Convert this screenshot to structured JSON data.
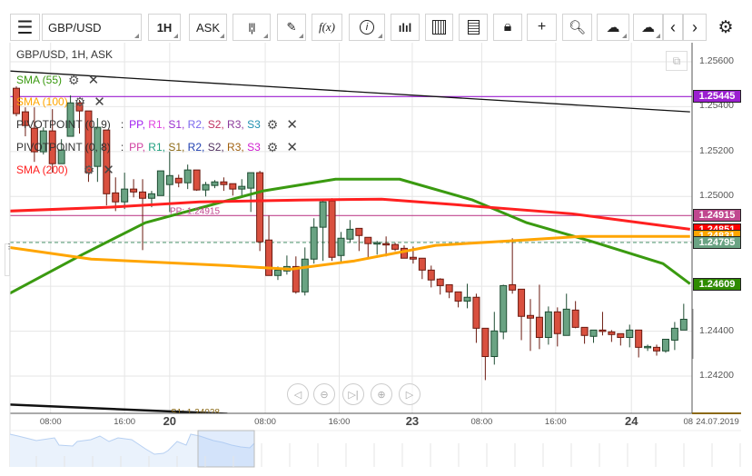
{
  "toolbar": {
    "menu_icon": "hamburger-icon",
    "symbol": "GBP/USD",
    "timeframe": "1H",
    "price_side": "ASK",
    "fx_label": "f(x)",
    "icons": [
      "candles-icon",
      "pen-icon",
      "function-icon",
      "info-icon",
      "bars-icon",
      "calendar-icon",
      "document-icon",
      "lock-icon",
      "crosshair-icon",
      "zoom-chart-icon",
      "cloud-upload-icon",
      "cloud-download-icon",
      "chevron-left-icon",
      "chevron-right-icon",
      "gear-icon"
    ]
  },
  "legend": {
    "title": "GBP/USD, 1H, ASK",
    "sma55": {
      "label": "SMA (55)",
      "color": "#3a9a10"
    },
    "sma100": {
      "label": "SMA (100)",
      "color": "#ffa500"
    },
    "pivot9": {
      "label": "PIVOTPOINT (0, 9)",
      "sep": ":",
      "items": [
        {
          "t": "PP",
          "c": "#a020f0"
        },
        {
          "t": "R1",
          "c": "#e040e0"
        },
        {
          "t": "S1",
          "c": "#9b30d0"
        },
        {
          "t": "R2",
          "c": "#7b68ee"
        },
        {
          "t": "S2",
          "c": "#c03060"
        },
        {
          "t": "R3",
          "c": "#8b3a9b"
        },
        {
          "t": "S3",
          "c": "#2090b0"
        }
      ]
    },
    "pivot8": {
      "label": "PIVOTPOINT (0, 8)",
      "sep": ":",
      "items": [
        {
          "t": "PP",
          "c": "#d040a0"
        },
        {
          "t": "R1",
          "c": "#20a080"
        },
        {
          "t": "S1",
          "c": "#8b6914"
        },
        {
          "t": "R2",
          "c": "#2040b0"
        },
        {
          "t": "S2",
          "c": "#503060"
        },
        {
          "t": "R3",
          "c": "#a06010"
        },
        {
          "t": "S3",
          "c": "#d020d0"
        }
      ]
    },
    "sma200": {
      "label": "SMA (200)",
      "color": "#ff2020"
    }
  },
  "chart_data": {
    "type": "candlestick",
    "symbol": "GBP/USD",
    "interval": "1H",
    "ylim": [
      1.2415,
      1.2567
    ],
    "yticks": [
      "1.25600",
      "1.25400",
      "1.25200",
      "1.25000",
      "1.24800",
      "1.24600",
      "1.24400",
      "1.24200"
    ],
    "ytick_values": [
      1.256,
      1.254,
      1.252,
      1.25,
      1.248,
      1.246,
      1.244,
      1.242
    ],
    "grid": true,
    "up_color": "#6aa383",
    "down_color": "#d9503f",
    "candles_ohlc": [
      [
        1.25482,
        1.2549,
        1.25357,
        1.25369
      ],
      [
        1.25377,
        1.25397,
        1.25268,
        1.25316
      ],
      [
        1.25304,
        1.25397,
        1.25154,
        1.25199
      ],
      [
        1.25199,
        1.25308,
        1.25187,
        1.25292
      ],
      [
        1.25292,
        1.25389,
        1.25106,
        1.25146
      ],
      [
        1.25146,
        1.25255,
        1.25146,
        1.25207
      ],
      [
        1.25268,
        1.2545,
        1.25268,
        1.25417
      ],
      [
        1.25417,
        1.2543,
        1.2528,
        1.25381
      ],
      [
        1.25381,
        1.25381,
        1.25065,
        1.25106
      ],
      [
        1.25134,
        1.25349,
        1.25065,
        1.25308
      ],
      [
        1.25296,
        1.25296,
        1.2496,
        1.25012
      ],
      [
        1.25016,
        1.25085,
        1.24935,
        1.24976
      ],
      [
        1.24976,
        1.25106,
        1.24944,
        1.25033
      ],
      [
        1.25033,
        1.25077,
        1.24996,
        1.2502
      ],
      [
        1.2502,
        1.25077,
        1.24761,
        1.24992
      ],
      [
        1.24992,
        1.25025,
        1.24952,
        1.25012
      ],
      [
        1.25004,
        1.25114,
        1.25004,
        1.25114
      ],
      [
        1.25053,
        1.25199,
        1.24931,
        1.25093
      ],
      [
        1.25081,
        1.25097,
        1.25041,
        1.25061
      ],
      [
        1.25061,
        1.25142,
        1.25033,
        1.25118
      ],
      [
        1.25118,
        1.25118,
        1.25025,
        1.25029
      ],
      [
        1.25029,
        1.25065,
        1.25,
        1.25053
      ],
      [
        1.25049,
        1.25073,
        1.25037,
        1.25065
      ],
      [
        1.25065,
        1.25085,
        1.25025,
        1.25053
      ],
      [
        1.25057,
        1.25057,
        1.25004,
        1.25033
      ],
      [
        1.25033,
        1.25077,
        1.25004,
        1.25045
      ],
      [
        1.25037,
        1.25106,
        1.24931,
        1.25106
      ],
      [
        1.25106,
        1.25114,
        1.24757,
        1.24798
      ],
      [
        1.24806,
        1.24915,
        1.24648,
        1.24648
      ],
      [
        1.24648,
        1.24688,
        1.24628,
        1.24672
      ],
      [
        1.24668,
        1.24737,
        1.24652,
        1.24688
      ],
      [
        1.24688,
        1.24733,
        1.24567,
        1.24575
      ],
      [
        1.24575,
        1.24773,
        1.24559,
        1.24721
      ],
      [
        1.24721,
        1.24903,
        1.24701,
        1.24863
      ],
      [
        1.24863,
        1.24988,
        1.24713,
        1.24976
      ],
      [
        1.2498,
        1.24992,
        1.24713,
        1.24729
      ],
      [
        1.24737,
        1.24842,
        1.24701,
        1.24814
      ],
      [
        1.2481,
        1.24895,
        1.24794,
        1.24854
      ],
      [
        1.24858,
        1.24858,
        1.24757,
        1.24826
      ],
      [
        1.24818,
        1.24818,
        1.24729,
        1.2479
      ],
      [
        1.2479,
        1.24802,
        1.24741,
        1.24794
      ],
      [
        1.2479,
        1.24822,
        1.24733,
        1.24786
      ],
      [
        1.24786,
        1.24794,
        1.24757,
        1.24765
      ],
      [
        1.24769,
        1.24782,
        1.24725,
        1.24725
      ],
      [
        1.24729,
        1.24777,
        1.24701,
        1.24721
      ],
      [
        1.24725,
        1.24725,
        1.24632,
        1.24672
      ],
      [
        1.24672,
        1.24692,
        1.24595,
        1.24628
      ],
      [
        1.24632,
        1.24636,
        1.24563,
        1.24603
      ],
      [
        1.24607,
        1.24607,
        1.24547,
        1.24575
      ],
      [
        1.24575,
        1.24575,
        1.24506,
        1.24534
      ],
      [
        1.24534,
        1.24611,
        1.24502,
        1.24551
      ],
      [
        1.24551,
        1.24567,
        1.24348,
        1.24413
      ],
      [
        1.24413,
        1.24413,
        1.24182,
        1.24287
      ],
      [
        1.24287,
        1.24486,
        1.24251,
        1.24401
      ],
      [
        1.24397,
        1.24607,
        1.24364,
        1.24603
      ],
      [
        1.24607,
        1.24814,
        1.24567,
        1.24583
      ],
      [
        1.24587,
        1.24587,
        1.2436,
        1.24466
      ],
      [
        1.2447,
        1.24543,
        1.24312,
        1.24458
      ],
      [
        1.24462,
        1.24607,
        1.2432,
        1.24372
      ],
      [
        1.24372,
        1.2451,
        1.2434,
        1.24486
      ],
      [
        1.24486,
        1.24506,
        1.24332,
        1.24389
      ],
      [
        1.24381,
        1.24567,
        1.24381,
        1.24498
      ],
      [
        1.24494,
        1.24534,
        1.24413,
        1.24417
      ],
      [
        1.24417,
        1.24417,
        1.24344,
        1.24381
      ],
      [
        1.24377,
        1.24405,
        1.24348,
        1.24405
      ],
      [
        1.24405,
        1.24486,
        1.24381,
        1.24401
      ],
      [
        1.24397,
        1.24405,
        1.24352,
        1.24385
      ],
      [
        1.24389,
        1.24389,
        1.24336,
        1.24372
      ],
      [
        1.24372,
        1.24429,
        1.24328,
        1.24405
      ],
      [
        1.24405,
        1.24405,
        1.24283,
        1.24328
      ],
      [
        1.24328,
        1.2434,
        1.24312,
        1.24332
      ],
      [
        1.24328,
        1.2434,
        1.24291,
        1.24312
      ],
      [
        1.24312,
        1.24364,
        1.24304,
        1.24364
      ],
      [
        1.2436,
        1.24441,
        1.24316,
        1.24413
      ],
      [
        1.24405,
        1.24522,
        1.24405,
        1.24453
      ]
    ],
    "sma55": [
      [
        -0.8,
        1.24567
      ],
      [
        7.3,
        1.24741
      ],
      [
        14.3,
        1.24883
      ],
      [
        27.4,
        1.25025
      ],
      [
        35.4,
        1.25077
      ],
      [
        42.5,
        1.25077
      ],
      [
        50.6,
        1.24984
      ],
      [
        56.6,
        1.24883
      ],
      [
        63.6,
        1.24802
      ],
      [
        71.7,
        1.24701
      ],
      [
        74.7,
        1.24611
      ]
    ],
    "sma100": [
      [
        -0.8,
        1.24773
      ],
      [
        8.3,
        1.24721
      ],
      [
        23.4,
        1.24692
      ],
      [
        30.4,
        1.24676
      ],
      [
        37.5,
        1.24713
      ],
      [
        46.5,
        1.24782
      ],
      [
        54.6,
        1.24802
      ],
      [
        62.6,
        1.24822
      ],
      [
        74.7,
        1.24822
      ]
    ],
    "sma200": [
      [
        -0.8,
        1.24935
      ],
      [
        10.3,
        1.24952
      ],
      [
        20.3,
        1.24976
      ],
      [
        31.4,
        1.24984
      ],
      [
        40.5,
        1.24988
      ],
      [
        48.5,
        1.24964
      ],
      [
        61.6,
        1.24923
      ],
      [
        74.7,
        1.24854
      ]
    ],
    "trendlines": [
      {
        "from": [
          -0.8,
          1.25559
        ],
        "to": [
          74.7,
          1.25377
        ],
        "color": "#111"
      },
      {
        "from": [
          -0.8,
          1.24073
        ],
        "to": [
          23.4,
          1.24032
        ],
        "color": "#111"
      }
    ],
    "hlines": [
      {
        "price": 1.25445,
        "color": "#9b1fd0"
      },
      {
        "price": 1.24915,
        "color": "#c0478f",
        "label": "PP: 1.24915"
      },
      {
        "price": 1.24795,
        "color": "#5fa07c",
        "dashed": true
      }
    ],
    "s1_label": "S1: 1.24028",
    "price_labels": [
      {
        "text": "1.25445",
        "bg": "#9b1fd0",
        "price": 1.25445
      },
      {
        "text": "1.24915",
        "bg": "#c0478f",
        "price": 1.24915
      },
      {
        "text": "1.24851",
        "bg": "#ff0000",
        "price": 1.24851
      },
      {
        "text": "1.24831",
        "bg": "#ffa500",
        "price": 1.24822
      },
      {
        "text": "1.24795",
        "bg": "#6aa383",
        "price": 1.24795
      },
      {
        "text": "1.24609",
        "bg": "#2e8b00",
        "price": 1.24609
      }
    ],
    "xticks": [
      {
        "t": "08:00",
        "bar": 3.8,
        "day": false
      },
      {
        "t": "16:00",
        "bar": 12,
        "day": false
      },
      {
        "t": "20",
        "bar": 17,
        "day": true
      },
      {
        "t": "08:00",
        "bar": 27.6,
        "day": false
      },
      {
        "t": "16:00",
        "bar": 35.8,
        "day": false
      },
      {
        "t": "23",
        "bar": 43.9,
        "day": true
      },
      {
        "t": "08:00",
        "bar": 51.6,
        "day": false
      },
      {
        "t": "16:00",
        "bar": 59.8,
        "day": false
      },
      {
        "t": "24",
        "bar": 68.2,
        "day": true
      },
      {
        "t": "08",
        "bar": 74.5,
        "day": false
      }
    ],
    "current_date": "24.07.2019"
  },
  "nav_buttons": [
    "scroll-left",
    "zoom-out",
    "jump-to-latest",
    "zoom-in",
    "scroll-right"
  ]
}
